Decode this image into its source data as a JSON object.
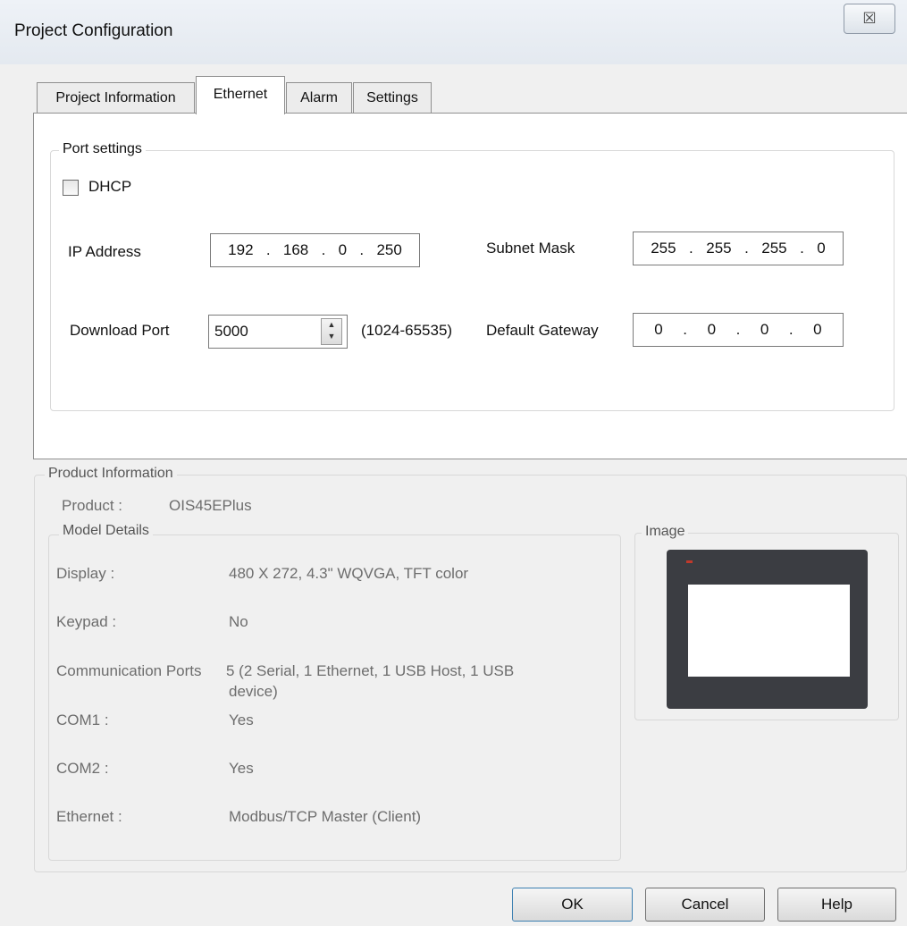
{
  "window": {
    "title": "Project Configuration",
    "close_glyph": "☒"
  },
  "tabs": [
    "Project Information",
    "Ethernet",
    "Alarm",
    "Settings"
  ],
  "port_settings": {
    "legend": "Port settings",
    "dhcp_label": "DHCP",
    "dhcp_checked": false,
    "ip_label": "IP Address",
    "ip": [
      "192",
      "168",
      "0",
      "250"
    ],
    "subnet_label": "Subnet Mask",
    "subnet": [
      "255",
      "255",
      "255",
      "0"
    ],
    "port_label": "Download Port",
    "port_value": "5000",
    "port_range": "(1024-65535)",
    "gateway_label": "Default Gateway",
    "gateway": [
      "0",
      "0",
      "0",
      "0"
    ],
    "dot": "."
  },
  "product_info": {
    "legend": "Product Information",
    "product_label": "Product :",
    "product_value": "OIS45EPlus",
    "model_legend": "Model Details",
    "rows": [
      {
        "label": "Display :",
        "value": "480 X 272, 4.3\" WQVGA, TFT color"
      },
      {
        "label": "Keypad :",
        "value": "No"
      },
      {
        "label": "Communication Ports",
        "value": "5 (2 Serial, 1 Ethernet, 1 USB Host, 1 USB",
        "value_line2": "device)"
      },
      {
        "label": "COM1 :",
        "value": "Yes"
      },
      {
        "label": "COM2 :",
        "value": "Yes"
      },
      {
        "label": "Ethernet :",
        "value": "Modbus/TCP Master (Client)"
      }
    ],
    "image_legend": "Image"
  },
  "buttons": {
    "ok": "OK",
    "cancel": "Cancel",
    "help": "Help"
  }
}
